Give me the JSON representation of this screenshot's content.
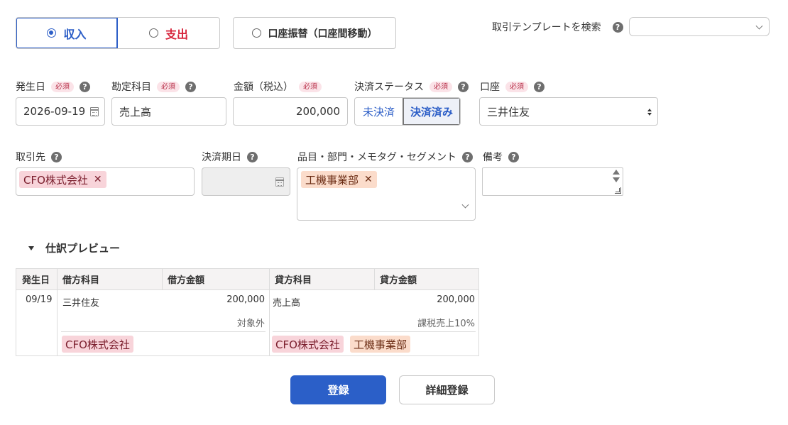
{
  "type_tabs": {
    "income": "収入",
    "expense": "支出",
    "transfer": "口座振替（口座間移動）"
  },
  "template_search": {
    "label": "取引テンプレートを検索",
    "value": ""
  },
  "help_glyph": "?",
  "required_badge": "必須",
  "fields": {
    "issue_date": {
      "label": "発生日",
      "value": "2026-09-19"
    },
    "account_item": {
      "label": "勘定科目",
      "value": "売上高"
    },
    "amount": {
      "label": "金額（税込）",
      "value": "200,000"
    },
    "settlement_status": {
      "label": "決済ステータス",
      "options": [
        "未決済",
        "決済済み"
      ],
      "selected": "決済済み"
    },
    "wallet": {
      "label": "口座",
      "value": "三井住友"
    },
    "partner": {
      "label": "取引先",
      "tag": "CFO株式会社"
    },
    "due_date": {
      "label": "決済期日",
      "value": ""
    },
    "tags": {
      "label": "品目・部門・メモタグ・セグメント",
      "tag": "工機事業部"
    },
    "memo": {
      "label": "備考",
      "value": ""
    }
  },
  "preview": {
    "title": "仕訳プレビュー",
    "headers": [
      "発生日",
      "借方科目",
      "借方金額",
      "貸方科目",
      "貸方金額"
    ],
    "row": {
      "date": "09/19",
      "debit_account": "三井住友",
      "debit_amount": "200,000",
      "debit_tax": "対象外",
      "credit_account": "売上高",
      "credit_amount": "200,000",
      "credit_tax": "課税売上10%",
      "debit_tags": [
        "CFO株式会社"
      ],
      "credit_tags": [
        "CFO株式会社",
        "工機事業部"
      ]
    }
  },
  "buttons": {
    "register": "登録",
    "detail_register": "詳細登録"
  },
  "colors": {
    "primary": "#2b5fc8",
    "expense_red": "#d7263d",
    "tag_pink": "#f8d4da",
    "tag_peach": "#fbdccb"
  }
}
